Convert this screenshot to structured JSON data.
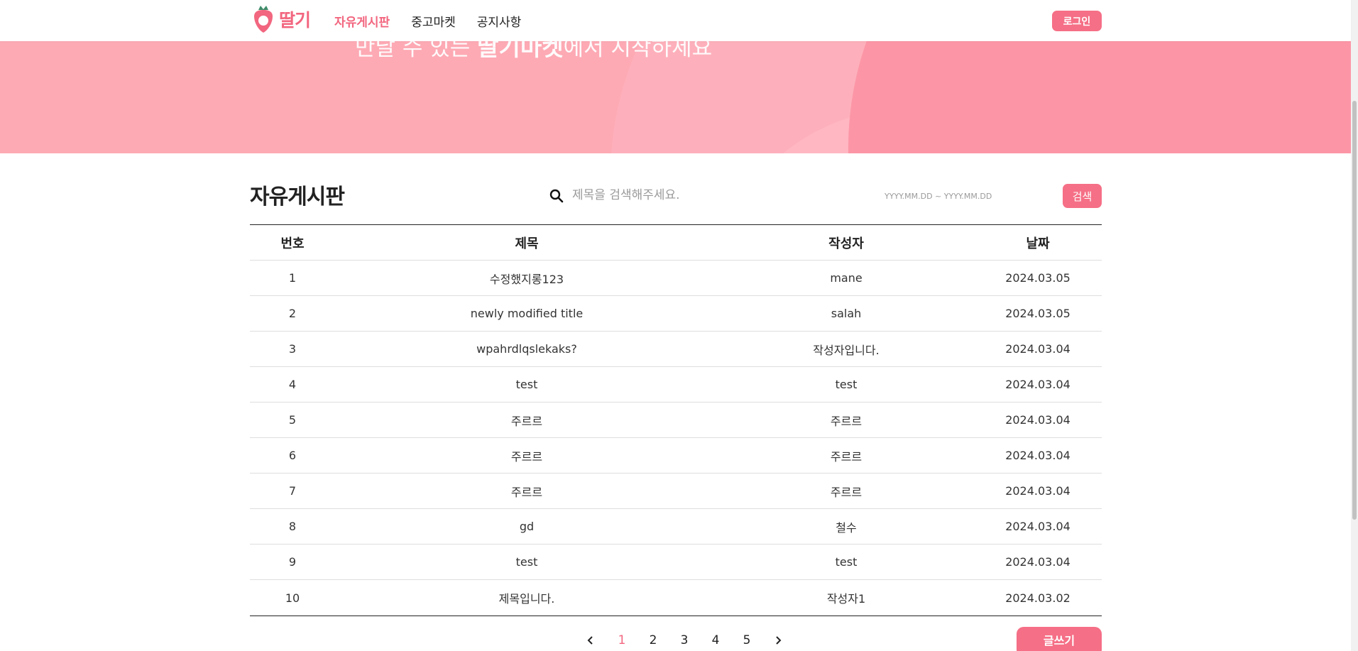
{
  "header": {
    "logo_text": "딸기",
    "nav": [
      "자유게시판",
      "중고마켓",
      "공지사항"
    ],
    "login_label": "로그인"
  },
  "banner": {
    "text_pre": "만날 수 있는 ",
    "text_bold": "딸기마켓",
    "text_post": "에서 시작하세요"
  },
  "board": {
    "title": "자유게시판",
    "search_placeholder": "제목을 검색해주세요.",
    "date_placeholder": "YYYY.MM.DD ~ YYYY.MM.DD",
    "search_button": "검색",
    "columns": [
      "번호",
      "제목",
      "작성자",
      "날짜"
    ],
    "rows": [
      {
        "num": "1",
        "title": "수정했지롱123",
        "author": "mane",
        "date": "2024.03.05"
      },
      {
        "num": "2",
        "title": "newly modified title",
        "author": "salah",
        "date": "2024.03.05"
      },
      {
        "num": "3",
        "title": "wpahrdlqslekaks?",
        "author": "작성자입니다.",
        "date": "2024.03.04"
      },
      {
        "num": "4",
        "title": "test",
        "author": "test",
        "date": "2024.03.04"
      },
      {
        "num": "5",
        "title": "주르르",
        "author": "주르르",
        "date": "2024.03.04"
      },
      {
        "num": "6",
        "title": "주르르",
        "author": "주르르",
        "date": "2024.03.04"
      },
      {
        "num": "7",
        "title": "주르르",
        "author": "주르르",
        "date": "2024.03.04"
      },
      {
        "num": "8",
        "title": "gd",
        "author": "철수",
        "date": "2024.03.04"
      },
      {
        "num": "9",
        "title": "test",
        "author": "test",
        "date": "2024.03.04"
      },
      {
        "num": "10",
        "title": "제목입니다.",
        "author": "작성자1",
        "date": "2024.03.02"
      }
    ]
  },
  "pagination": {
    "pages": [
      "1",
      "2",
      "3",
      "4",
      "5"
    ],
    "current": "1"
  },
  "write_button": "글쓰기",
  "colors": {
    "accent": "#f56f86",
    "accent_text": "#f2667f",
    "banner": "#fdaab4"
  },
  "icons": [
    "strawberry-logo-icon",
    "search-icon",
    "chevron-left-icon",
    "chevron-right-icon"
  ]
}
